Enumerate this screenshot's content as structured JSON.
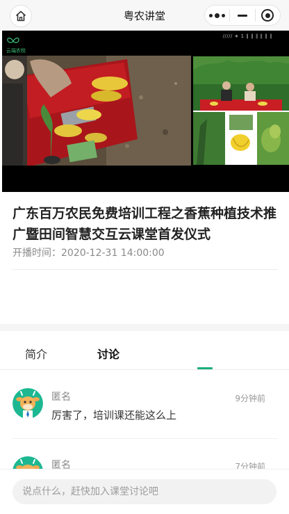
{
  "navbar": {
    "title": "粤农讲堂",
    "home_icon": "home-icon",
    "menu_icon": "more-dots-icon",
    "minimize_icon": "minimize-icon",
    "close_icon": "target-close-icon"
  },
  "video": {
    "logo_text": "云端农校",
    "top_caption": "∕∕∕∕∕ ∗ 1 ∥ ∥ ∥ ∥ ∥ ∥"
  },
  "course": {
    "title": "广东百万农民免费培训工程之香蕉种植技术推广暨田间智慧交互云课堂首发仪式",
    "live_time": "开播时间：2020-12-31 14:00:00"
  },
  "tabs": [
    {
      "label": "简介",
      "active": false
    },
    {
      "label": "讨论",
      "active": true
    }
  ],
  "comments": [
    {
      "name": "匿名",
      "time": "9分钟前",
      "text": "厉害了，培训课还能这么上",
      "avatar_icon": "cartoon-cow-avatar-icon"
    },
    {
      "name": "匿名",
      "time": "7分钟前",
      "text": "",
      "avatar_icon": "cartoon-cow-avatar-icon"
    }
  ],
  "input": {
    "placeholder": "说点什么，赶快加入课堂讨论吧"
  },
  "colors": {
    "accent": "#1aad7c",
    "avatar_bg": "#1db892"
  }
}
